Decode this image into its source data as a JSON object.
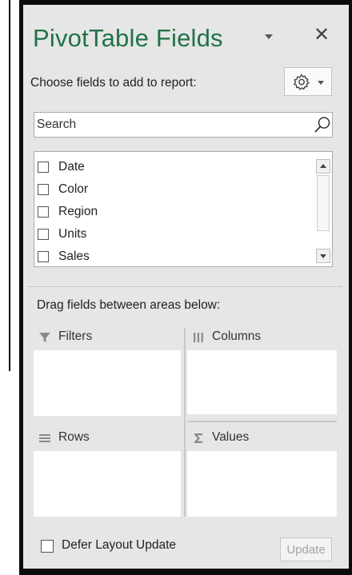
{
  "pane": {
    "title": "PivotTable Fields",
    "close_glyph": "✕",
    "choose_label": "Choose fields to add to report:",
    "tools_icon": "gear-icon",
    "accent_color": "#217346"
  },
  "search": {
    "placeholder": "Search",
    "value": ""
  },
  "fields": [
    {
      "label": "Date",
      "checked": false
    },
    {
      "label": "Color",
      "checked": false
    },
    {
      "label": "Region",
      "checked": false
    },
    {
      "label": "Units",
      "checked": false
    },
    {
      "label": "Sales",
      "checked": false
    }
  ],
  "areas": {
    "drag_label": "Drag fields between areas below:",
    "filters": {
      "label": "Filters",
      "icon": "filter-icon"
    },
    "columns": {
      "label": "Columns",
      "icon": "columns-icon"
    },
    "rows": {
      "label": "Rows",
      "icon": "rows-icon"
    },
    "values": {
      "label": "Values",
      "icon": "sigma-icon"
    }
  },
  "footer": {
    "defer_label": "Defer Layout Update",
    "defer_checked": false,
    "update_label": "Update",
    "update_enabled": false
  }
}
